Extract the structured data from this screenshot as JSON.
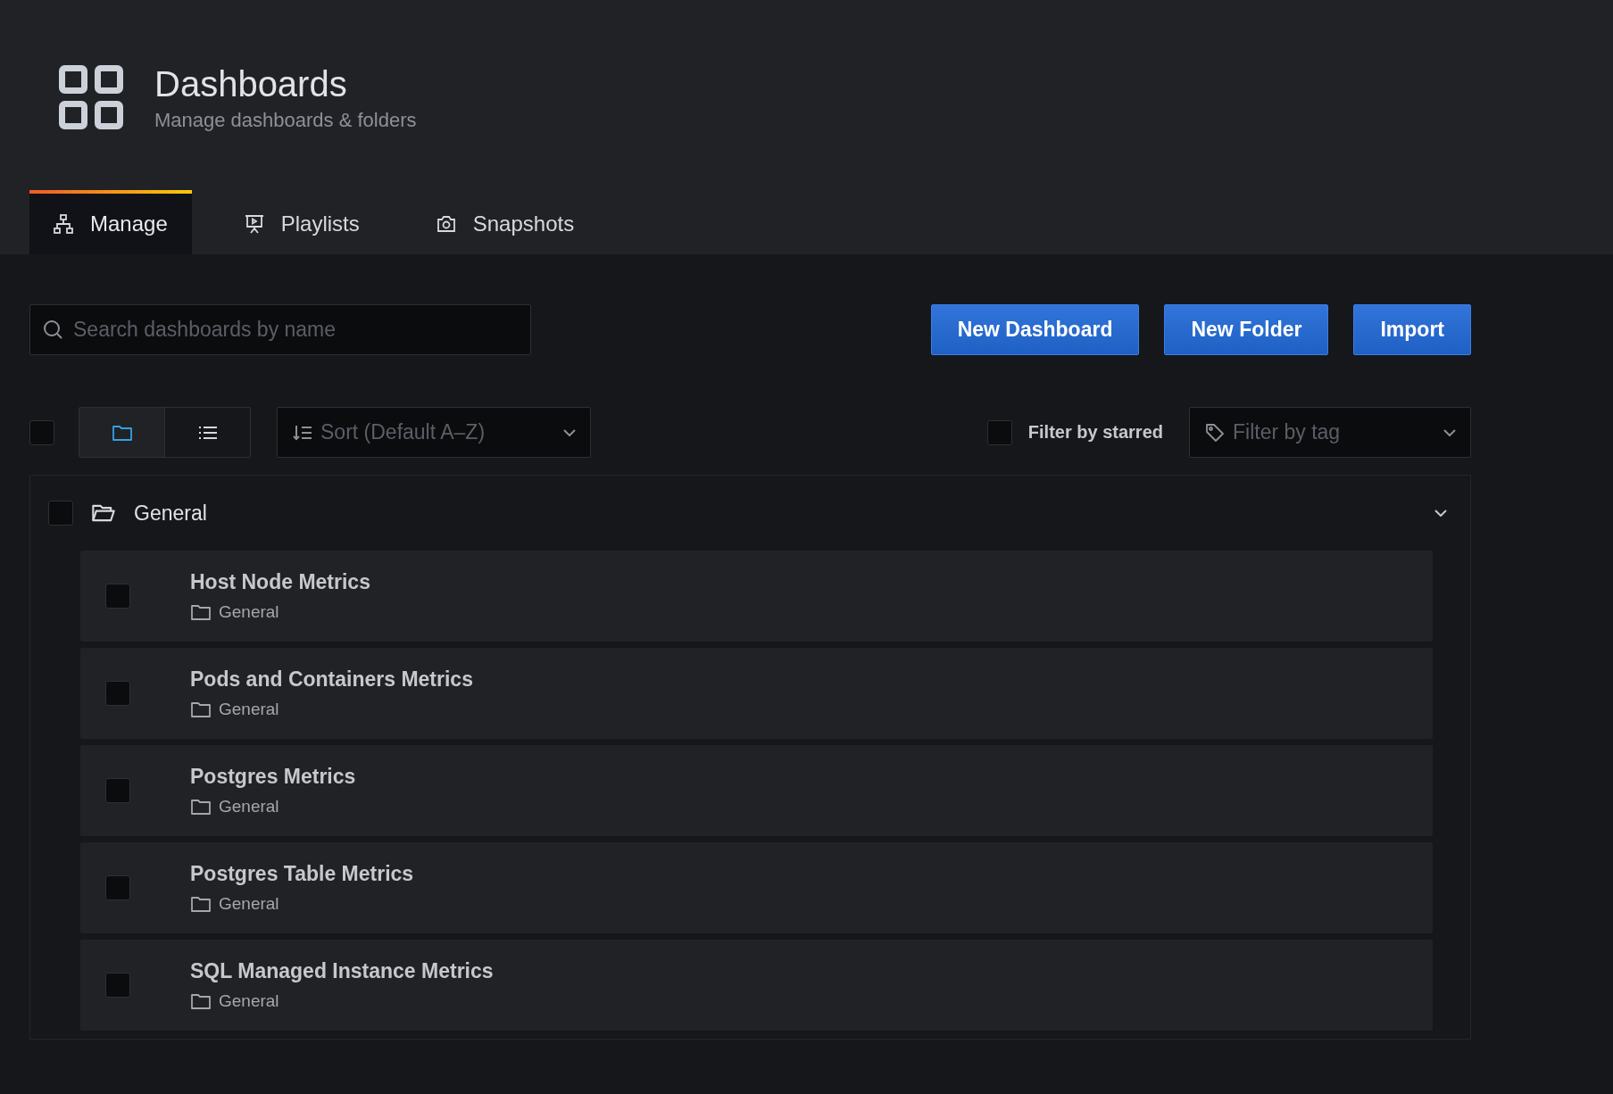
{
  "header": {
    "title": "Dashboards",
    "subtitle": "Manage dashboards & folders"
  },
  "tabs": [
    {
      "label": "Manage",
      "kind": "manage",
      "selected": true
    },
    {
      "label": "Playlists",
      "kind": "playlists",
      "selected": false
    },
    {
      "label": "Snapshots",
      "kind": "snapshots",
      "selected": false
    }
  ],
  "search": {
    "placeholder": "Search dashboards by name"
  },
  "buttons": [
    "New Dashboard",
    "New Folder",
    "Import"
  ],
  "toolbar": {
    "select_all": {
      "checked": false
    },
    "view_modes": [
      {
        "kind": "folders",
        "selected": true
      },
      {
        "kind": "list",
        "selected": false
      }
    ],
    "sort": {
      "value": "Sort (Default A–Z)"
    },
    "starred_filter": {
      "label": "Filter by starred",
      "checked": false
    },
    "tag_filter": {
      "placeholder": "Filter by tag"
    }
  },
  "folders": [
    {
      "name": "General",
      "checked": false,
      "expanded": true,
      "dashboards": [
        {
          "title": "Host Node Metrics",
          "folder": "General",
          "checked": false
        },
        {
          "title": "Pods and Containers Metrics",
          "folder": "General",
          "checked": false
        },
        {
          "title": "Postgres Metrics",
          "folder": "General",
          "checked": false
        },
        {
          "title": "Postgres Table Metrics",
          "folder": "General",
          "checked": false
        },
        {
          "title": "SQL Managed Instance Metrics",
          "folder": "General",
          "checked": false
        }
      ]
    }
  ]
}
